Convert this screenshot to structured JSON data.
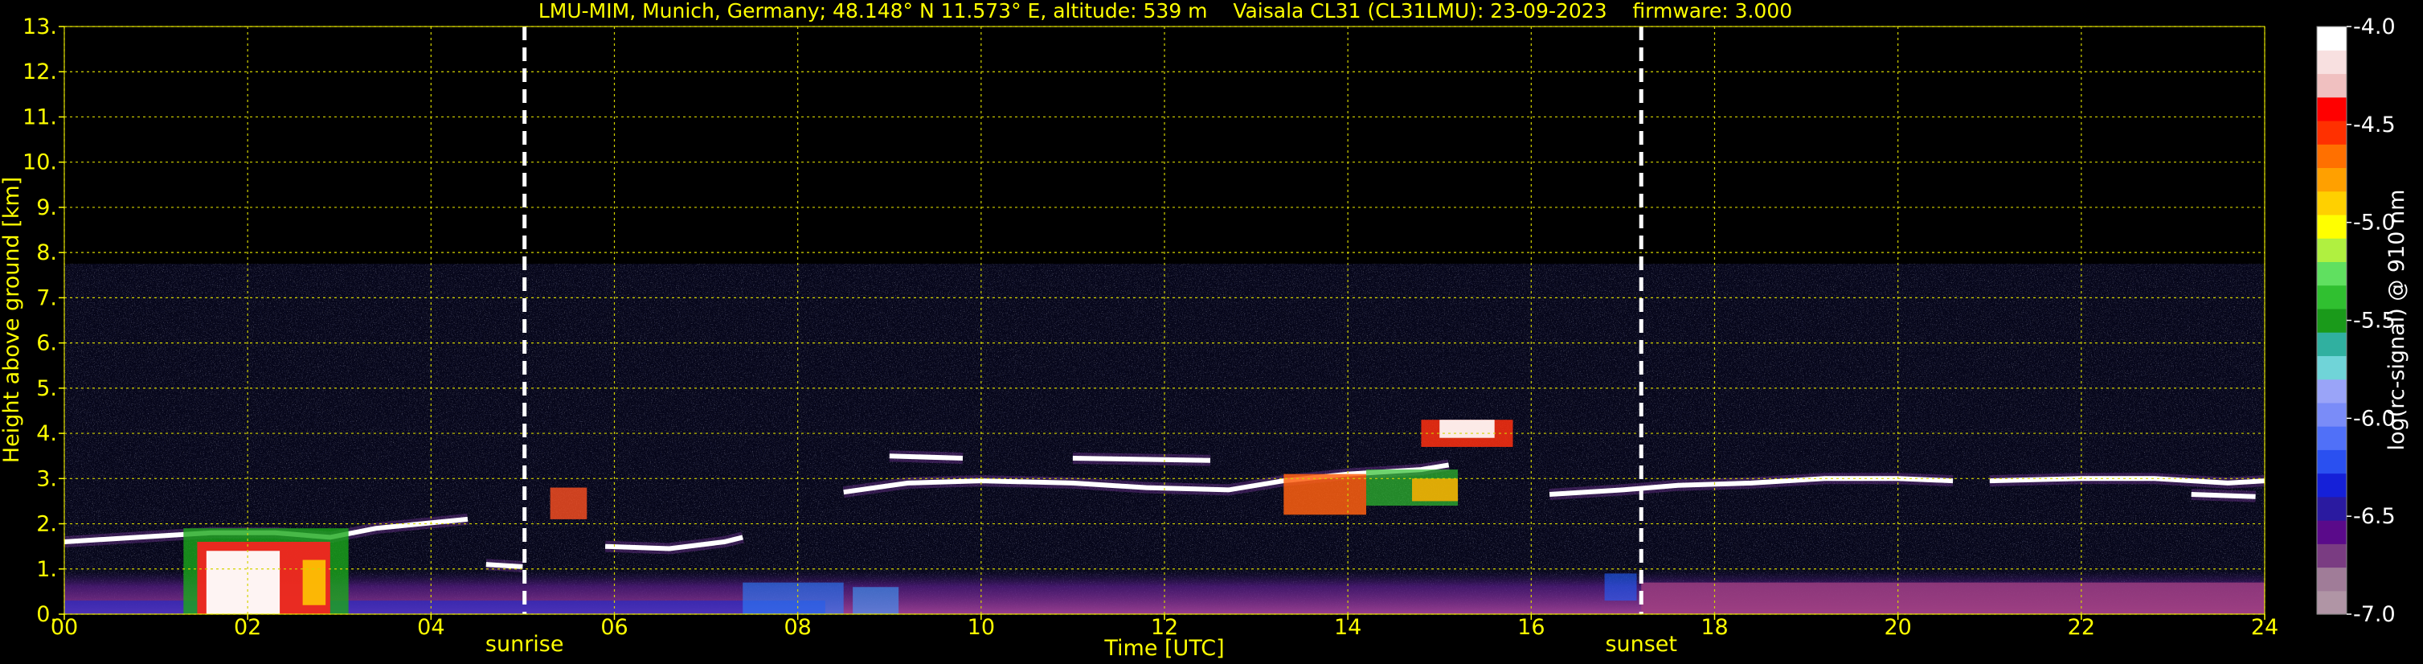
{
  "chart_data": {
    "type": "heatmap",
    "title": "LMU-MIM, Munich, Germany; 48.148° N 11.573° E, altitude: 539 m    Vaisala CL31 (CL31LMU): 23-09-2023    firmware: 3.000",
    "xlabel": "Time [UTC]",
    "ylabel": "Height above ground [km]",
    "xlim": [
      0,
      24
    ],
    "ylim": [
      0,
      13
    ],
    "x_ticks": [
      "00",
      "02",
      "04",
      "06",
      "08",
      "10",
      "12",
      "14",
      "16",
      "18",
      "20",
      "22",
      "24"
    ],
    "y_ticks": [
      "0.",
      "1.",
      "2.",
      "3.",
      "4.",
      "5.",
      "6.",
      "7.",
      "8.",
      "9.",
      "10.",
      "11.",
      "12.",
      "13."
    ],
    "grid": true,
    "markers": [
      {
        "label": "sunrise",
        "x": 5.02
      },
      {
        "label": "sunset",
        "x": 17.2
      }
    ],
    "colorbar": {
      "label": "log(rc-signal) @ 910 nm",
      "ticks": [
        "-4.0",
        "-4.5",
        "-5.0",
        "-5.5",
        "-6.0",
        "-6.5",
        "-7.0"
      ],
      "range": [
        -7.0,
        -4.0
      ],
      "colors": [
        "#b095a5",
        "#a07c98",
        "#7a3c82",
        "#5a0a8a",
        "#2a1aa0",
        "#1520d8",
        "#2a50f0",
        "#5070f8",
        "#7a8cf8",
        "#9aa4f8",
        "#70d4d8",
        "#30b0a0",
        "#1a9a1a",
        "#30c030",
        "#60e060",
        "#b0f040",
        "#ffff00",
        "#ffd000",
        "#ffa000",
        "#ff7000",
        "#ff3000",
        "#ff0000",
        "#f0c0c0",
        "#f8e0e0",
        "#ffffff"
      ]
    },
    "features": [
      {
        "name": "boundary layer aerosol",
        "time": [
          0,
          24
        ],
        "height_km": [
          0,
          0.9
        ]
      },
      {
        "name": "cloud layer morning",
        "time": [
          0,
          4.4
        ],
        "height_km": [
          1.5,
          2.0
        ]
      },
      {
        "name": "dense low cloud / precipitation",
        "time": [
          1.3,
          3.1
        ],
        "height_km": [
          0,
          1.8
        ]
      },
      {
        "name": "cloud layer mid",
        "time": [
          5.9,
          7.4
        ],
        "height_km": [
          1.5,
          1.7
        ]
      },
      {
        "name": "cloud layer 2.8-3.5 km",
        "time": [
          8.5,
          16.0
        ],
        "height_km": [
          2.6,
          3.5
        ]
      },
      {
        "name": "strong backscatter",
        "time": [
          13.3,
          15.3
        ],
        "height_km": [
          2.3,
          4.3
        ]
      },
      {
        "name": "cloud layer evening",
        "time": [
          16.2,
          24
        ],
        "height_km": [
          2.6,
          3.1
        ]
      }
    ]
  }
}
